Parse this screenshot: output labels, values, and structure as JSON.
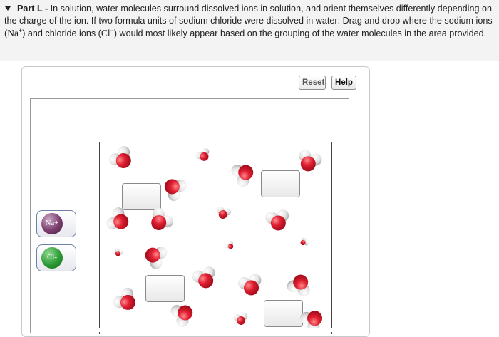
{
  "question": {
    "part_label": "Part L -",
    "text_1": "In solution, water molecules surround dissolved ions in solution, and orient themselves differently depending on the charge of the ion. If two formula units of sodium chloride were dissolved in water: Drag and drop where the sodium ions (",
    "na_symbol": "Na",
    "na_charge": "+",
    "text_2": ") and chloride ions (",
    "cl_symbol": "Cl",
    "cl_charge": "−",
    "text_3": ") would most likely appear based on the grouping of the water molecules in the area provided."
  },
  "toolbar": {
    "reset_label": "Reset",
    "help_label": "Help"
  },
  "palette": {
    "na_label": "Na+",
    "cl_label": "Cl-"
  },
  "colors": {
    "oxygen": "#d4142a",
    "hydrogen": "#e8e8e8",
    "sodium": "#7a3d6e",
    "chloride": "#2c9a35",
    "tile_border": "#6f7fa6"
  },
  "drop_targets": [
    "drop-target-1",
    "drop-target-2",
    "drop-target-3",
    "drop-target-4"
  ]
}
